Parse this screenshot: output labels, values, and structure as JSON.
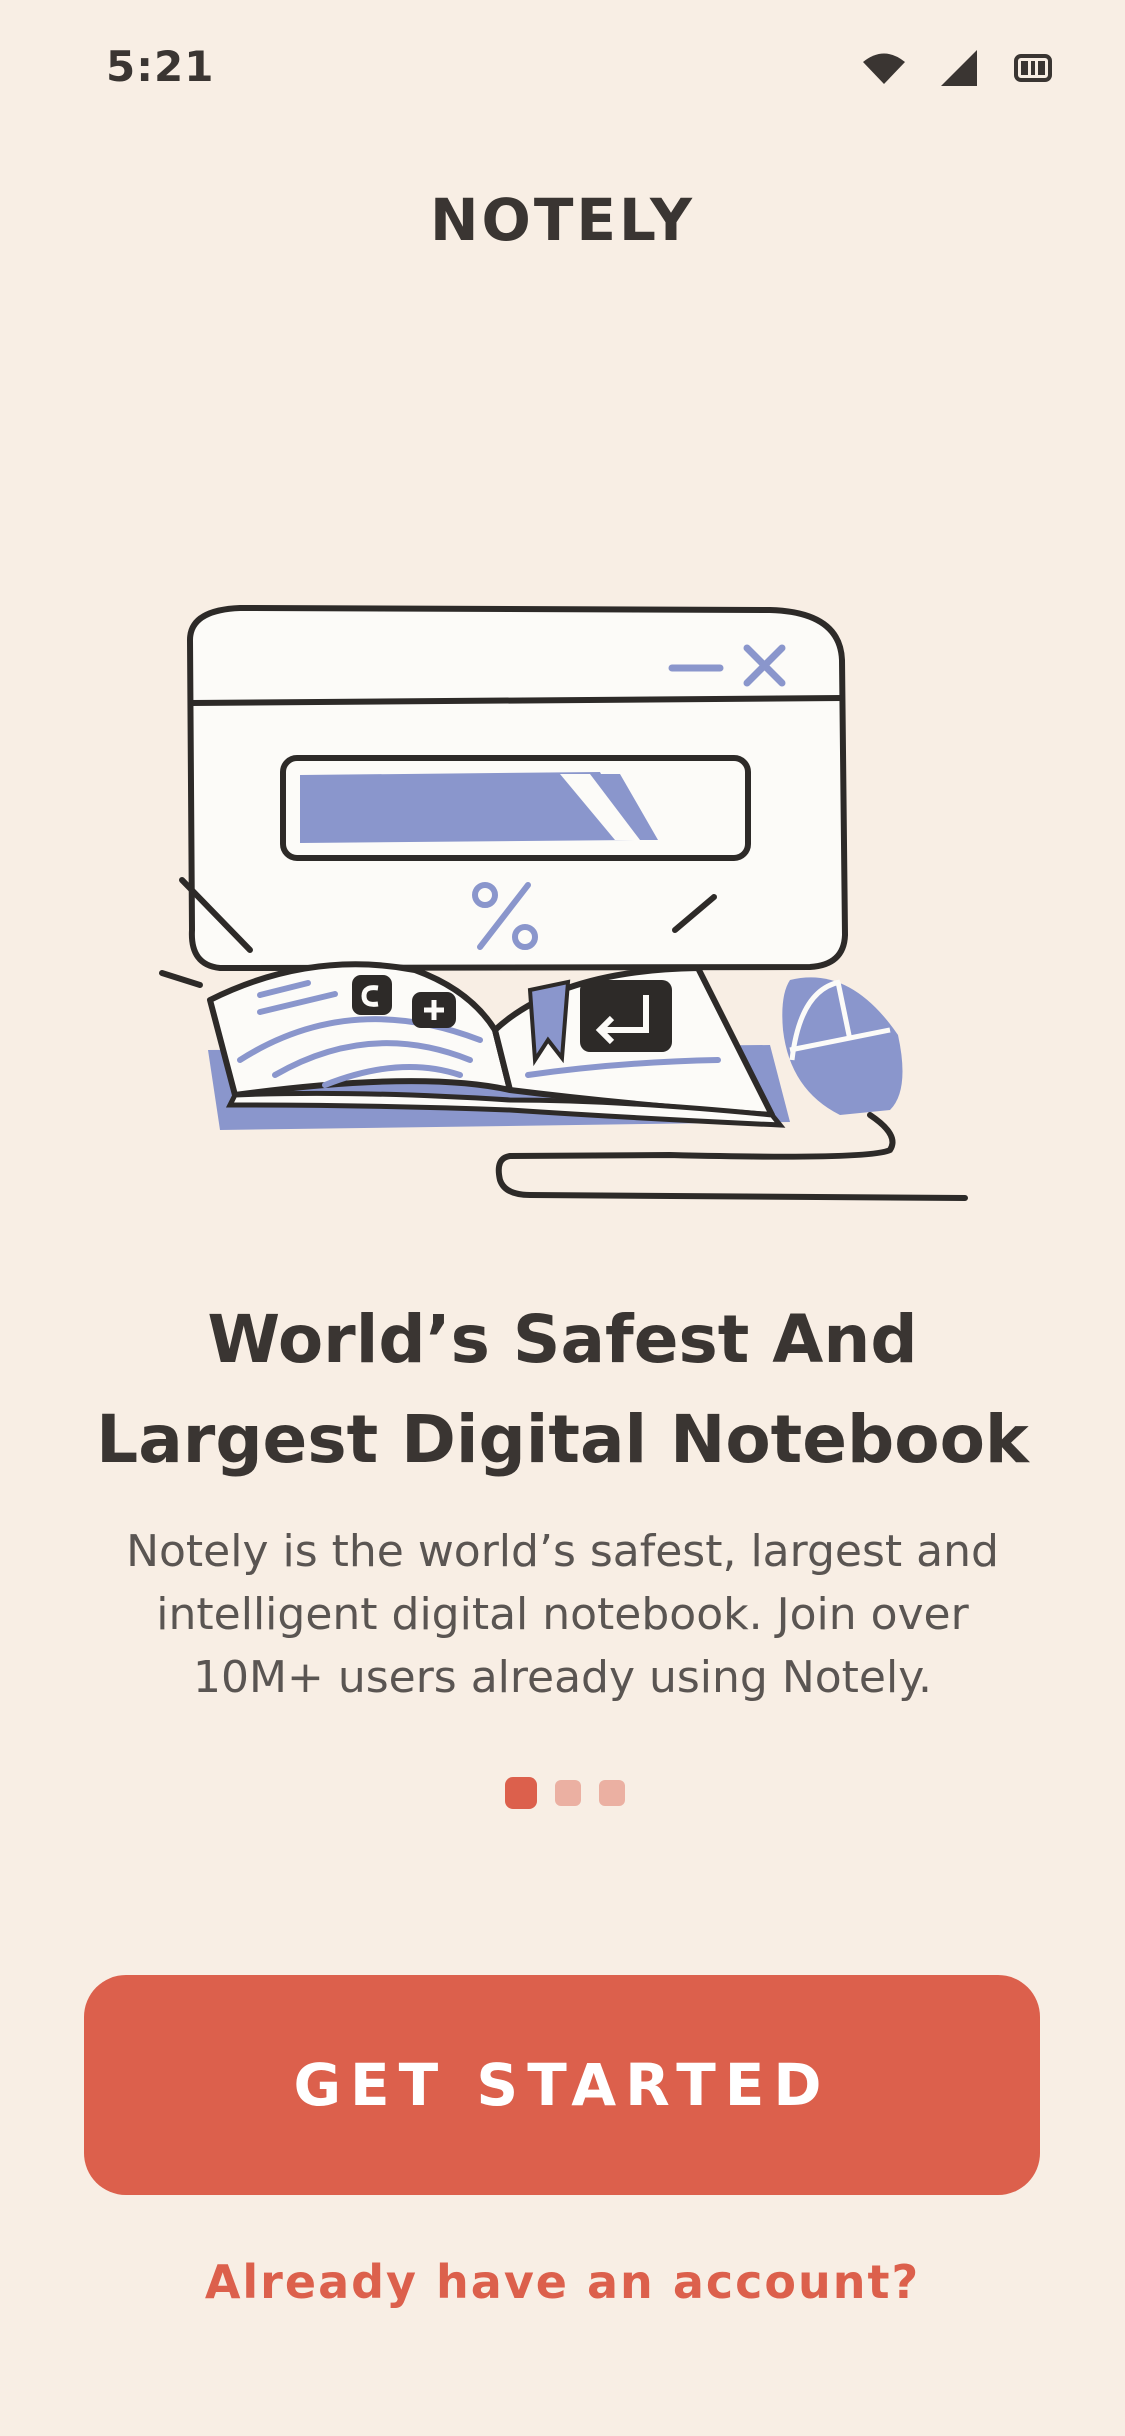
{
  "status_bar": {
    "time": "5:21",
    "icons": [
      "wifi-icon",
      "signal-icon",
      "battery-icon"
    ]
  },
  "app": {
    "title": "NOTELY"
  },
  "illustration": {
    "icon": "notebook-computer-illustration"
  },
  "onboarding": {
    "headline": "World’s Safest And Largest Digital Notebook",
    "description": "Notely is the world’s safest, largest and intelligent digital notebook. Join over 10M+ users already using Notely.",
    "page_count": 3,
    "active_page": 1
  },
  "actions": {
    "primary_label": "GET STARTED",
    "secondary_label": "Already have an account?"
  },
  "colors": {
    "background": "#F8EEE4",
    "accent": "#DC604C",
    "text": "#3A3532",
    "illustration_blue": "#8A96CC"
  }
}
